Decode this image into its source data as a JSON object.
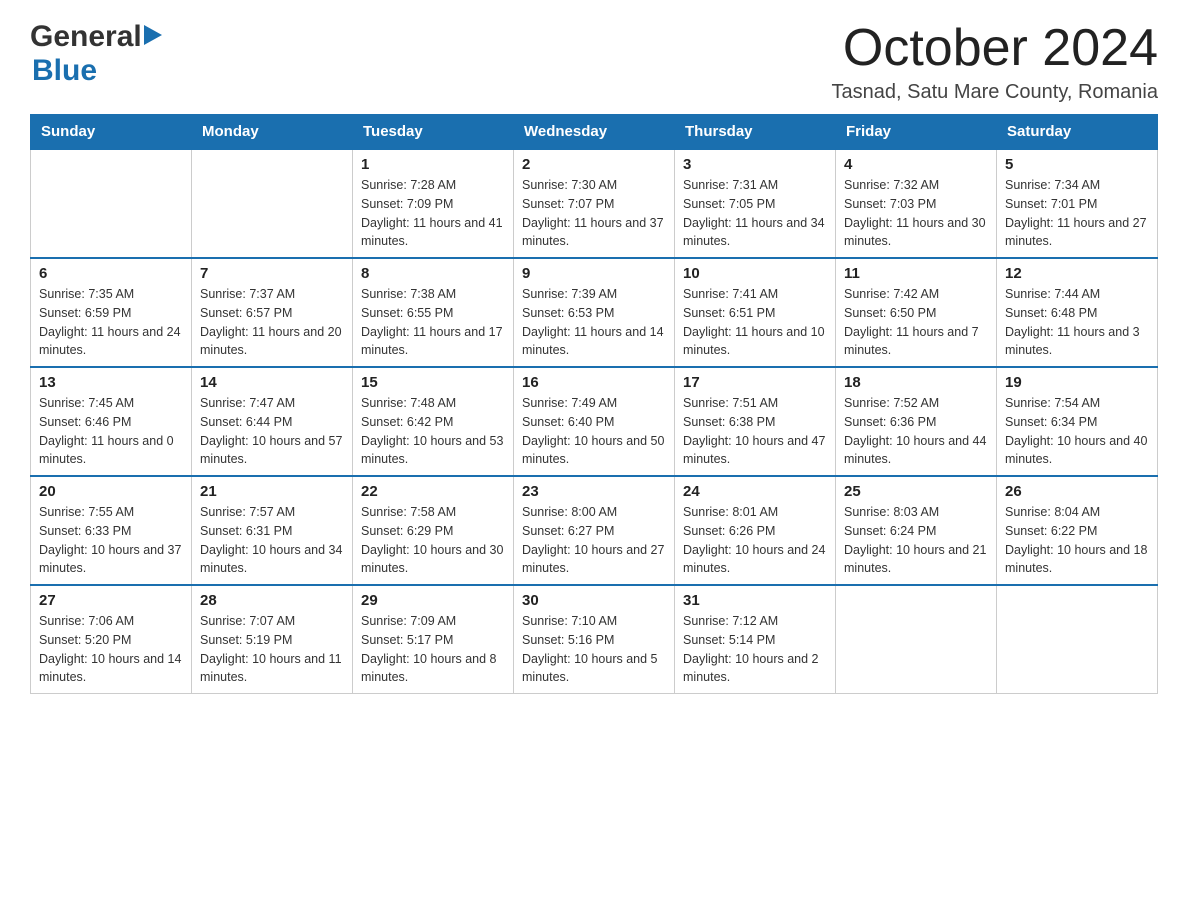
{
  "header": {
    "logo": {
      "general": "General",
      "blue": "Blue"
    },
    "title": "October 2024",
    "location": "Tasnad, Satu Mare County, Romania"
  },
  "weekdays": [
    "Sunday",
    "Monday",
    "Tuesday",
    "Wednesday",
    "Thursday",
    "Friday",
    "Saturday"
  ],
  "weeks": [
    [
      {
        "day": "",
        "sunrise": "",
        "sunset": "",
        "daylight": ""
      },
      {
        "day": "",
        "sunrise": "",
        "sunset": "",
        "daylight": ""
      },
      {
        "day": "1",
        "sunrise": "Sunrise: 7:28 AM",
        "sunset": "Sunset: 7:09 PM",
        "daylight": "Daylight: 11 hours and 41 minutes."
      },
      {
        "day": "2",
        "sunrise": "Sunrise: 7:30 AM",
        "sunset": "Sunset: 7:07 PM",
        "daylight": "Daylight: 11 hours and 37 minutes."
      },
      {
        "day": "3",
        "sunrise": "Sunrise: 7:31 AM",
        "sunset": "Sunset: 7:05 PM",
        "daylight": "Daylight: 11 hours and 34 minutes."
      },
      {
        "day": "4",
        "sunrise": "Sunrise: 7:32 AM",
        "sunset": "Sunset: 7:03 PM",
        "daylight": "Daylight: 11 hours and 30 minutes."
      },
      {
        "day": "5",
        "sunrise": "Sunrise: 7:34 AM",
        "sunset": "Sunset: 7:01 PM",
        "daylight": "Daylight: 11 hours and 27 minutes."
      }
    ],
    [
      {
        "day": "6",
        "sunrise": "Sunrise: 7:35 AM",
        "sunset": "Sunset: 6:59 PM",
        "daylight": "Daylight: 11 hours and 24 minutes."
      },
      {
        "day": "7",
        "sunrise": "Sunrise: 7:37 AM",
        "sunset": "Sunset: 6:57 PM",
        "daylight": "Daylight: 11 hours and 20 minutes."
      },
      {
        "day": "8",
        "sunrise": "Sunrise: 7:38 AM",
        "sunset": "Sunset: 6:55 PM",
        "daylight": "Daylight: 11 hours and 17 minutes."
      },
      {
        "day": "9",
        "sunrise": "Sunrise: 7:39 AM",
        "sunset": "Sunset: 6:53 PM",
        "daylight": "Daylight: 11 hours and 14 minutes."
      },
      {
        "day": "10",
        "sunrise": "Sunrise: 7:41 AM",
        "sunset": "Sunset: 6:51 PM",
        "daylight": "Daylight: 11 hours and 10 minutes."
      },
      {
        "day": "11",
        "sunrise": "Sunrise: 7:42 AM",
        "sunset": "Sunset: 6:50 PM",
        "daylight": "Daylight: 11 hours and 7 minutes."
      },
      {
        "day": "12",
        "sunrise": "Sunrise: 7:44 AM",
        "sunset": "Sunset: 6:48 PM",
        "daylight": "Daylight: 11 hours and 3 minutes."
      }
    ],
    [
      {
        "day": "13",
        "sunrise": "Sunrise: 7:45 AM",
        "sunset": "Sunset: 6:46 PM",
        "daylight": "Daylight: 11 hours and 0 minutes."
      },
      {
        "day": "14",
        "sunrise": "Sunrise: 7:47 AM",
        "sunset": "Sunset: 6:44 PM",
        "daylight": "Daylight: 10 hours and 57 minutes."
      },
      {
        "day": "15",
        "sunrise": "Sunrise: 7:48 AM",
        "sunset": "Sunset: 6:42 PM",
        "daylight": "Daylight: 10 hours and 53 minutes."
      },
      {
        "day": "16",
        "sunrise": "Sunrise: 7:49 AM",
        "sunset": "Sunset: 6:40 PM",
        "daylight": "Daylight: 10 hours and 50 minutes."
      },
      {
        "day": "17",
        "sunrise": "Sunrise: 7:51 AM",
        "sunset": "Sunset: 6:38 PM",
        "daylight": "Daylight: 10 hours and 47 minutes."
      },
      {
        "day": "18",
        "sunrise": "Sunrise: 7:52 AM",
        "sunset": "Sunset: 6:36 PM",
        "daylight": "Daylight: 10 hours and 44 minutes."
      },
      {
        "day": "19",
        "sunrise": "Sunrise: 7:54 AM",
        "sunset": "Sunset: 6:34 PM",
        "daylight": "Daylight: 10 hours and 40 minutes."
      }
    ],
    [
      {
        "day": "20",
        "sunrise": "Sunrise: 7:55 AM",
        "sunset": "Sunset: 6:33 PM",
        "daylight": "Daylight: 10 hours and 37 minutes."
      },
      {
        "day": "21",
        "sunrise": "Sunrise: 7:57 AM",
        "sunset": "Sunset: 6:31 PM",
        "daylight": "Daylight: 10 hours and 34 minutes."
      },
      {
        "day": "22",
        "sunrise": "Sunrise: 7:58 AM",
        "sunset": "Sunset: 6:29 PM",
        "daylight": "Daylight: 10 hours and 30 minutes."
      },
      {
        "day": "23",
        "sunrise": "Sunrise: 8:00 AM",
        "sunset": "Sunset: 6:27 PM",
        "daylight": "Daylight: 10 hours and 27 minutes."
      },
      {
        "day": "24",
        "sunrise": "Sunrise: 8:01 AM",
        "sunset": "Sunset: 6:26 PM",
        "daylight": "Daylight: 10 hours and 24 minutes."
      },
      {
        "day": "25",
        "sunrise": "Sunrise: 8:03 AM",
        "sunset": "Sunset: 6:24 PM",
        "daylight": "Daylight: 10 hours and 21 minutes."
      },
      {
        "day": "26",
        "sunrise": "Sunrise: 8:04 AM",
        "sunset": "Sunset: 6:22 PM",
        "daylight": "Daylight: 10 hours and 18 minutes."
      }
    ],
    [
      {
        "day": "27",
        "sunrise": "Sunrise: 7:06 AM",
        "sunset": "Sunset: 5:20 PM",
        "daylight": "Daylight: 10 hours and 14 minutes."
      },
      {
        "day": "28",
        "sunrise": "Sunrise: 7:07 AM",
        "sunset": "Sunset: 5:19 PM",
        "daylight": "Daylight: 10 hours and 11 minutes."
      },
      {
        "day": "29",
        "sunrise": "Sunrise: 7:09 AM",
        "sunset": "Sunset: 5:17 PM",
        "daylight": "Daylight: 10 hours and 8 minutes."
      },
      {
        "day": "30",
        "sunrise": "Sunrise: 7:10 AM",
        "sunset": "Sunset: 5:16 PM",
        "daylight": "Daylight: 10 hours and 5 minutes."
      },
      {
        "day": "31",
        "sunrise": "Sunrise: 7:12 AM",
        "sunset": "Sunset: 5:14 PM",
        "daylight": "Daylight: 10 hours and 2 minutes."
      },
      {
        "day": "",
        "sunrise": "",
        "sunset": "",
        "daylight": ""
      },
      {
        "day": "",
        "sunrise": "",
        "sunset": "",
        "daylight": ""
      }
    ]
  ]
}
